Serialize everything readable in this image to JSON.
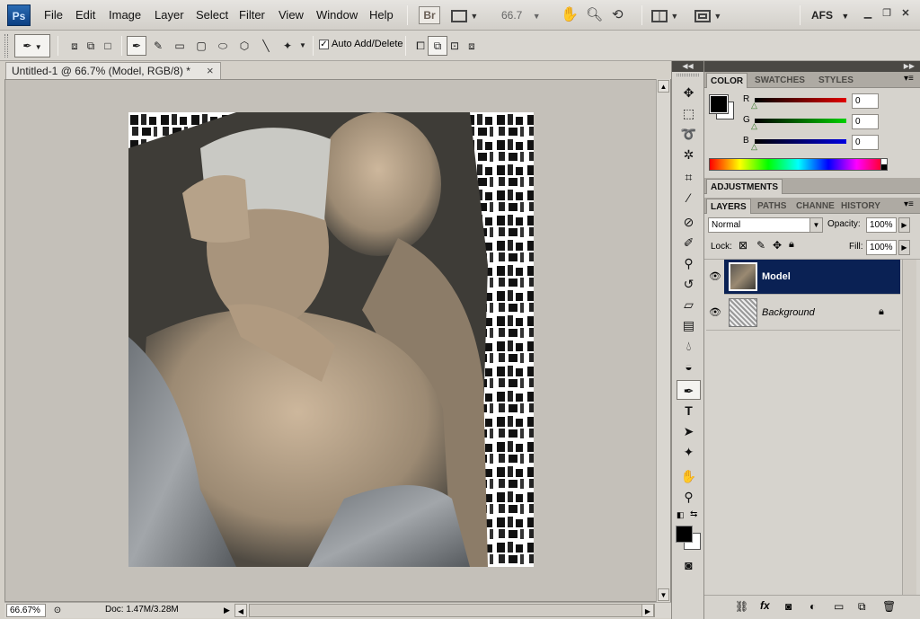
{
  "app": {
    "logo": "Ps"
  },
  "menu": [
    "File",
    "Edit",
    "Image",
    "Layer",
    "Select",
    "Filter",
    "View",
    "Window",
    "Help"
  ],
  "appbar": {
    "bridge": "Br",
    "zoom": "66.7",
    "workspace": "AFS"
  },
  "options": {
    "auto_add_delete": "Auto Add/Delete"
  },
  "document": {
    "tab_title": "Untitled-1 @ 66.7% (Model, RGB/8) *",
    "close": "×"
  },
  "status": {
    "zoom": "66.67%",
    "doc_info": "Doc: 1.47M/3.28M"
  },
  "color_panel": {
    "tabs": [
      "COLOR",
      "SWATCHES",
      "STYLES"
    ],
    "r_label": "R",
    "g_label": "G",
    "b_label": "B",
    "r": "0",
    "g": "0",
    "b": "0",
    "fg": "#000000",
    "bg": "#ffffff"
  },
  "adjustments": {
    "tab": "ADJUSTMENTS"
  },
  "layers_panel": {
    "tabs": [
      "LAYERS",
      "PATHS",
      "CHANNE",
      "HISTORY"
    ],
    "blend_mode": "Normal",
    "opacity_label": "Opacity:",
    "opacity": "100%",
    "lock_label": "Lock:",
    "fill_label": "Fill:",
    "fill": "100%",
    "layers": [
      {
        "name": "Model",
        "selected": true
      },
      {
        "name": "Background",
        "locked": true
      }
    ]
  },
  "colors": {
    "selection": "#0a2154",
    "accent": "#2a6bb3"
  }
}
